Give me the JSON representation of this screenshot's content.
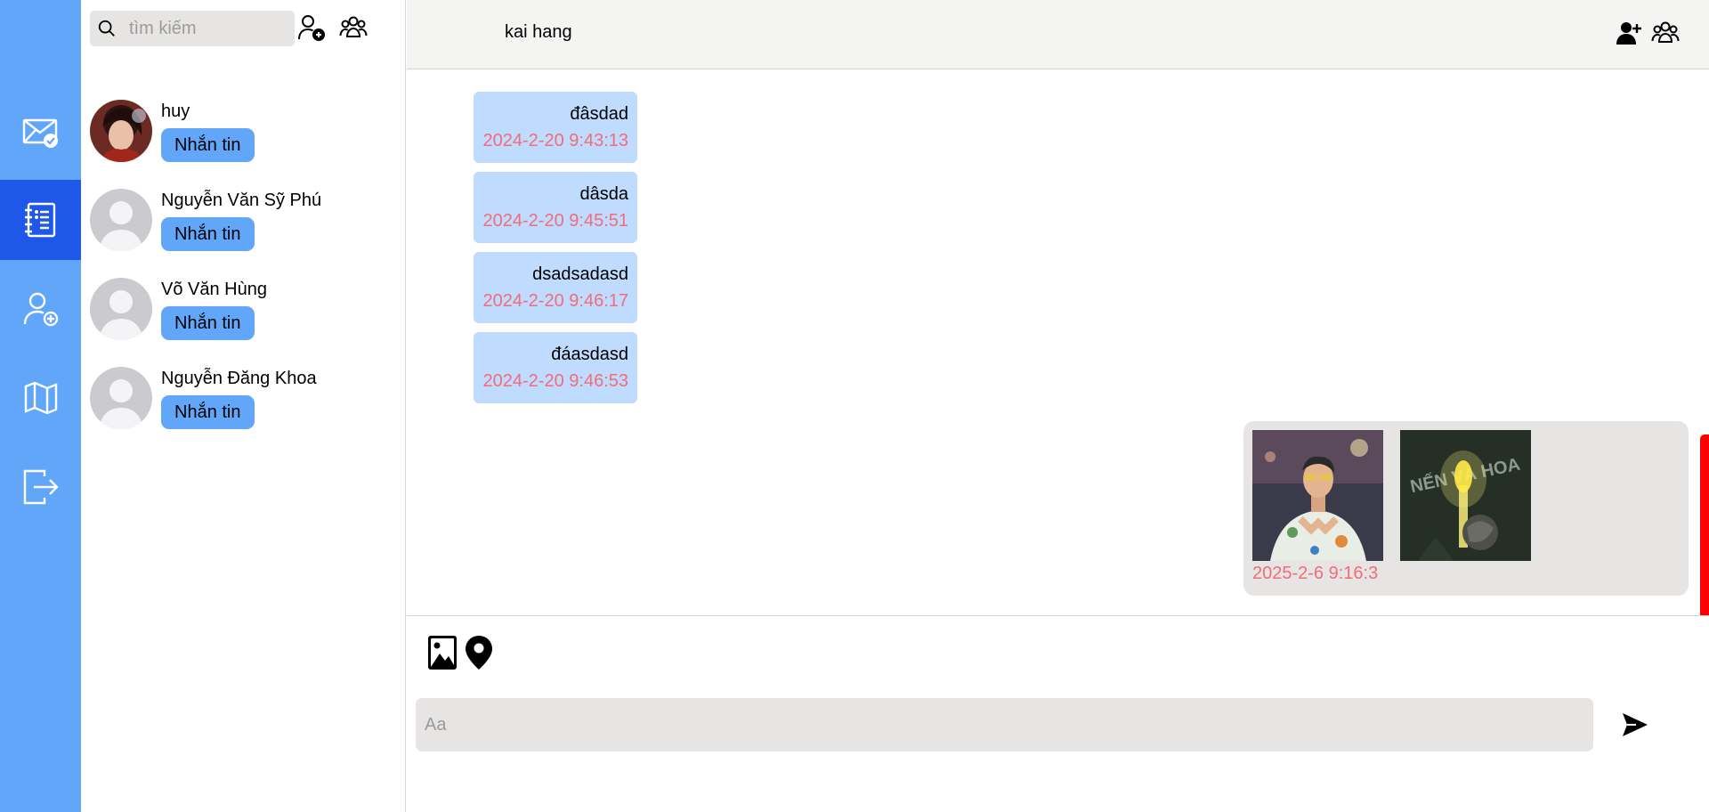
{
  "colors": {
    "rail": "#62a6f9",
    "rail_active": "#1f57e8",
    "button": "#62a6f9",
    "bubble": "#bfdbfe",
    "timestamp": "#f36c78",
    "scrollbar": "#ff0000"
  },
  "rail": {
    "items": [
      {
        "icon": "mail-check-icon",
        "active": false
      },
      {
        "icon": "contacts-book-icon",
        "active": true
      },
      {
        "icon": "add-user-icon",
        "active": false
      },
      {
        "icon": "map-icon",
        "active": false
      },
      {
        "icon": "logout-icon",
        "active": false
      }
    ]
  },
  "sidebar": {
    "search_placeholder": "tìm kiếm",
    "top_icons": [
      "add-friend-icon",
      "create-group-icon"
    ],
    "contacts": [
      {
        "name": "huy",
        "button": "Nhắn tin",
        "avatar": "photo"
      },
      {
        "name": "Nguyễn Văn Sỹ Phú",
        "button": "Nhắn tin",
        "avatar": "default"
      },
      {
        "name": "Võ Văn Hùng",
        "button": "Nhắn tin",
        "avatar": "default"
      },
      {
        "name": "Nguyễn Đăng Khoa",
        "button": "Nhắn tin",
        "avatar": "default"
      }
    ]
  },
  "chat": {
    "title": "kai hang",
    "header_icons": [
      "add-member-icon",
      "group-members-icon"
    ],
    "messages": [
      {
        "text": "đâsdad",
        "time": "2024-2-20 9:43:13"
      },
      {
        "text": "dâsda",
        "time": "2024-2-20 9:45:51"
      },
      {
        "text": "dsadsadasd",
        "time": "2024-2-20 9:46:17"
      },
      {
        "text": "đáasdasd",
        "time": "2024-2-20 9:46:53"
      }
    ],
    "image_message": {
      "images": [
        "person-photo",
        "candle-flower-photo"
      ],
      "image_caption": "NẾN VÀ HOA",
      "time": "2025-2-6 9:16:3"
    }
  },
  "composer": {
    "placeholder": "Aa",
    "icons": [
      "image-attach-icon",
      "location-pin-icon",
      "send-icon"
    ]
  }
}
